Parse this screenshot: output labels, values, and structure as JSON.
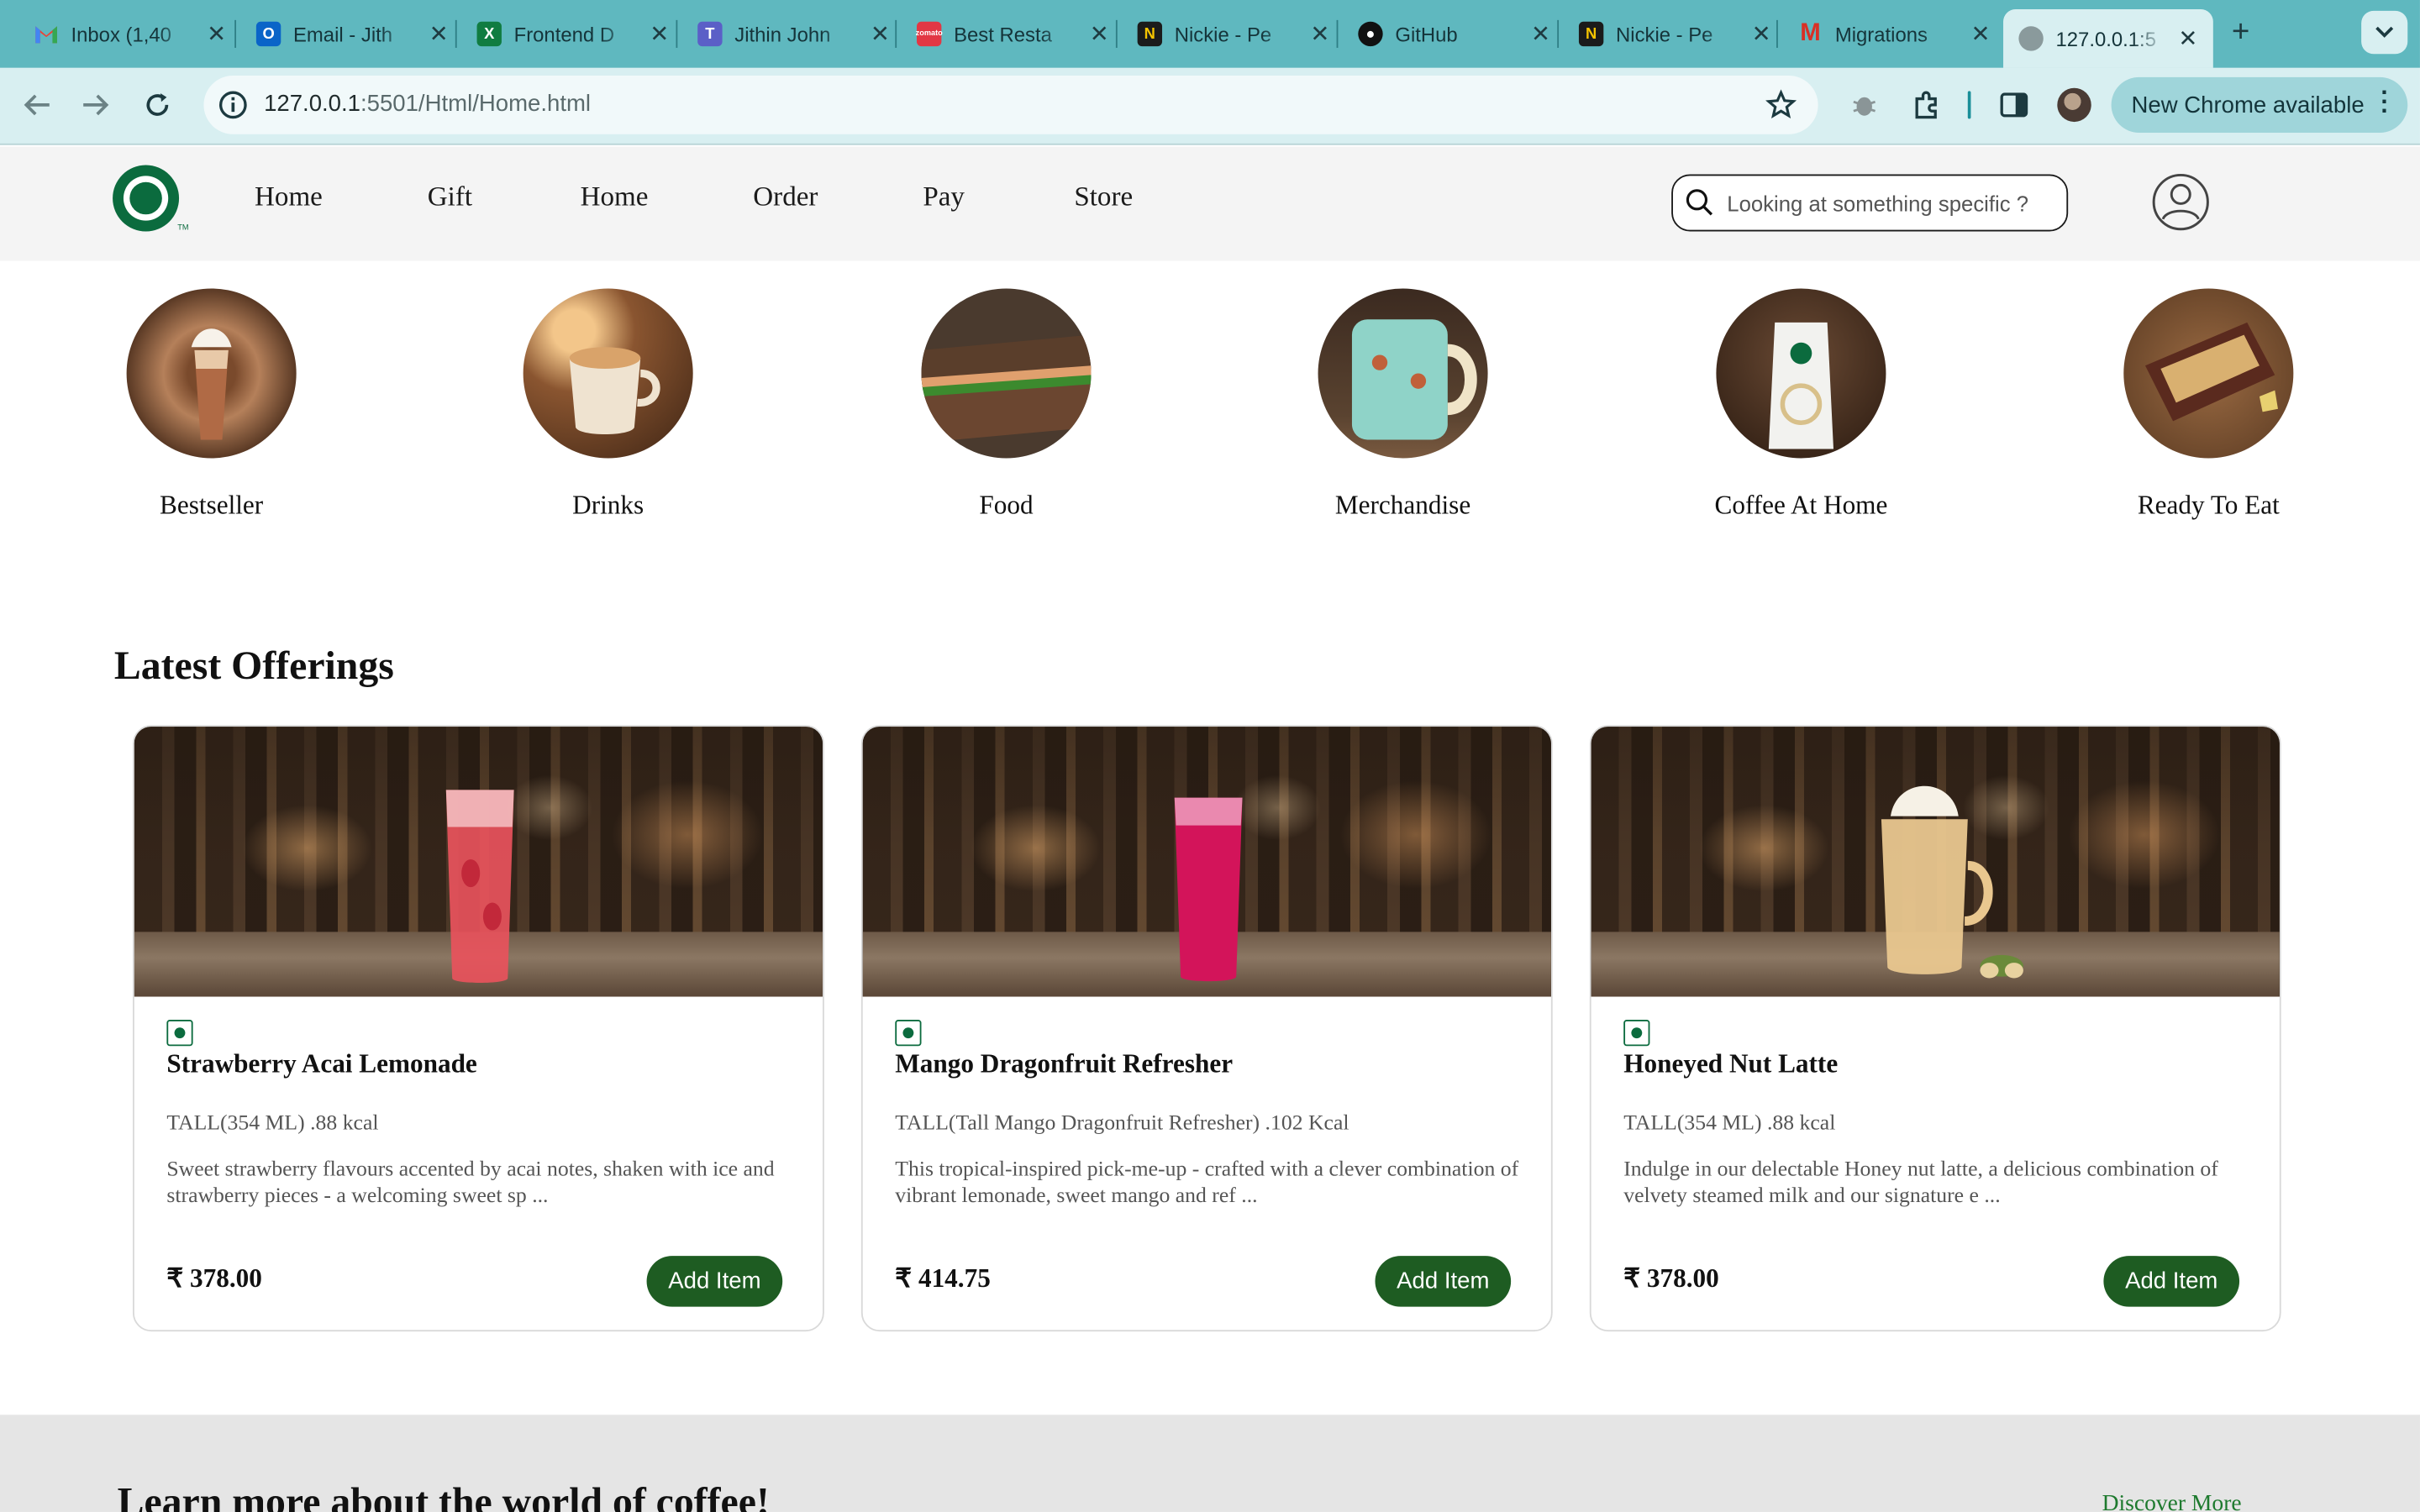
{
  "browser": {
    "tabs": [
      {
        "title": "Inbox (1,40",
        "icon": "gmail-icon",
        "color": "#ea4335"
      },
      {
        "title": "Email - Jith",
        "icon": "outlook-icon",
        "color": "#0a64c8"
      },
      {
        "title": "Frontend D",
        "icon": "excel-icon",
        "color": "#107c41"
      },
      {
        "title": "Jithin John",
        "icon": "teams-icon",
        "color": "#5b5fc7"
      },
      {
        "title": "Best Resta",
        "icon": "zomato-icon",
        "color": "#e23744"
      },
      {
        "title": "Nickie - Pe",
        "icon": "nickie-icon",
        "color": "#1b1b1b"
      },
      {
        "title": "GitHub",
        "icon": "github-icon",
        "color": "#111111"
      },
      {
        "title": "Nickie - Pe",
        "icon": "nickie-icon",
        "color": "#1b1b1b"
      },
      {
        "title": "Migrations",
        "icon": "m-icon",
        "color": "#d93025"
      },
      {
        "title": "127.0.0.1:5",
        "icon": "globe-icon",
        "color": "#6b7b7d"
      }
    ],
    "url_host": "127.0.0.1",
    "url_path": ":5501/Html/Home.html",
    "update_label": "New Chrome available"
  },
  "header": {
    "nav": [
      "Home",
      "Gift",
      "Home",
      "Order",
      "Pay",
      "Store"
    ],
    "search_placeholder": "Looking at something specific ?"
  },
  "categories": [
    "Bestseller",
    "Drinks",
    "Food",
    "Merchandise",
    "Coffee At Home",
    "Ready To Eat"
  ],
  "offerings": {
    "title": "Latest Offerings",
    "items": [
      {
        "name": "Strawberry Acai Lemonade",
        "size": "TALL(354 ML) .88 kcal",
        "desc": "Sweet strawberry flavours accented by acai notes, shaken with ice and strawberry pieces - a welcoming sweet sp ...",
        "price": "₹ 378.00",
        "button": "Add Item",
        "drink_color": "#e8525c"
      },
      {
        "name": "Mango Dragonfruit Refresher",
        "size": "TALL(Tall Mango Dragonfruit Refresher) .102 Kcal",
        "desc": "This tropical-inspired pick-me-up - crafted with a clever combination of vibrant lemonade, sweet mango and ref ...",
        "price": "₹ 414.75",
        "button": "Add Item",
        "drink_color": "#d3145a"
      },
      {
        "name": "Honeyed Nut Latte",
        "size": "TALL(354 ML) .88 kcal",
        "desc": "Indulge in our delectable Honey nut latte, a delicious combination of velvety steamed milk and our signature e ...",
        "price": "₹ 378.00",
        "button": "Add Item",
        "drink_color": "#e9c78f"
      }
    ]
  },
  "learn": {
    "title": "Learn more about the world of coffee!",
    "link": "Discover More"
  }
}
